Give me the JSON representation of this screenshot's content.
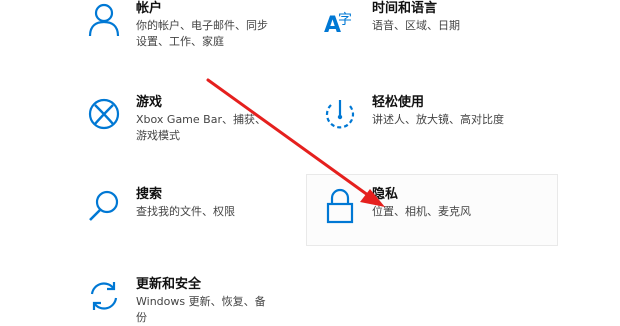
{
  "accent": "#0078d4",
  "arrow_color": "#e5201e",
  "tiles": [
    {
      "icon": "person-icon",
      "title": "帐户",
      "desc": "你的帐户、电子邮件、同步设置、工作、家庭"
    },
    {
      "icon": "language-icon",
      "title": "时间和语言",
      "desc": "语音、区域、日期"
    },
    {
      "icon": "xbox-icon",
      "title": "游戏",
      "desc": "Xbox Game Bar、捕获、游戏模式"
    },
    {
      "icon": "ease-of-access-icon",
      "title": "轻松使用",
      "desc": "讲述人、放大镜、高对比度"
    },
    {
      "icon": "search-icon",
      "title": "搜索",
      "desc": "查找我的文件、权限"
    },
    {
      "icon": "lock-icon",
      "title": "隐私",
      "desc": "位置、相机、麦克风"
    },
    {
      "icon": "sync-icon",
      "title": "更新和安全",
      "desc": "Windows 更新、恢复、备份"
    }
  ]
}
